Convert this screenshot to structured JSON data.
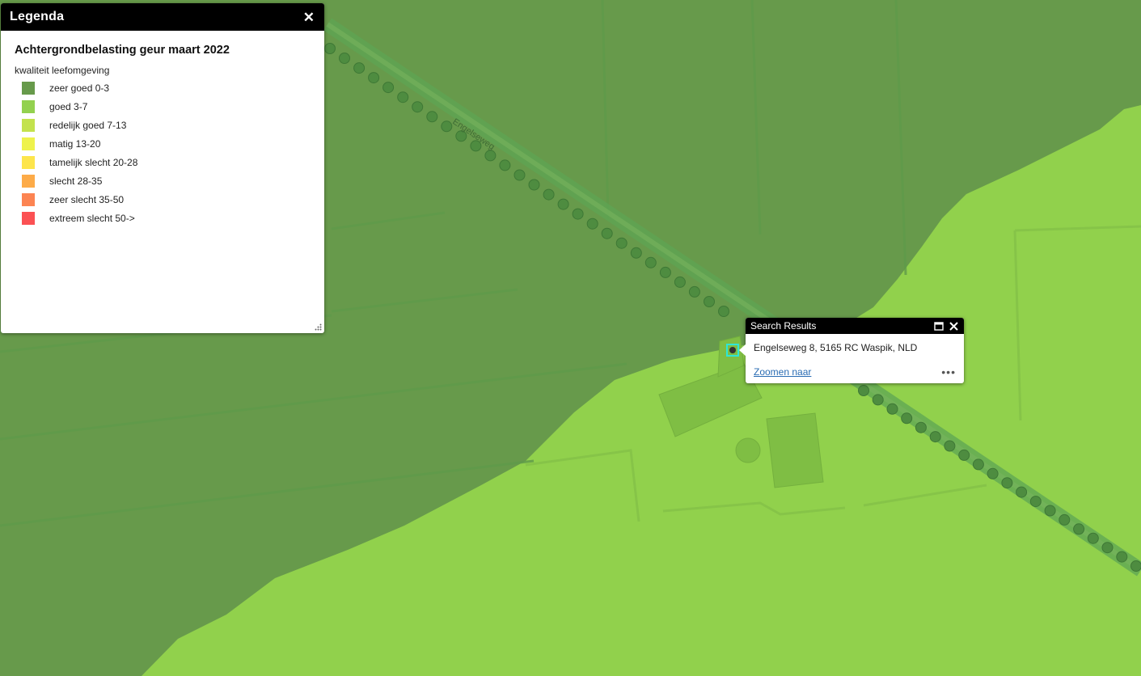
{
  "map": {
    "colors": {
      "dark_zone": "#679a4b",
      "light_zone": "#91d14c",
      "road": "#5aa255",
      "tree": "#4a8a3e"
    },
    "road_label": "Engelseweg"
  },
  "legend": {
    "title": "Legenda",
    "close_icon": "close-icon",
    "layer_title": "Achtergrondbelasting geur maart 2022",
    "field_label": "kwaliteit leefomgeving",
    "items": [
      {
        "label": "zeer goed 0-3",
        "color": "#679a4b"
      },
      {
        "label": "goed 3-7",
        "color": "#93d14f"
      },
      {
        "label": "redelijk goed 7-13",
        "color": "#c3e24d"
      },
      {
        "label": "matig 13-20",
        "color": "#eef24c"
      },
      {
        "label": "tamelijk slecht 20-28",
        "color": "#fde54c"
      },
      {
        "label": "slecht 28-35",
        "color": "#fdab48"
      },
      {
        "label": "zeer slecht 35-50",
        "color": "#fc8452"
      },
      {
        "label": "extreem slecht 50->",
        "color": "#fb5153"
      }
    ]
  },
  "popup": {
    "title": "Search Results",
    "address": "Engelseweg 8, 5165 RC Waspik, NLD",
    "zoom_link": "Zoomen naar",
    "more_icon": "•••",
    "maximize_icon": "maximize-icon",
    "close_icon": "close-icon"
  }
}
